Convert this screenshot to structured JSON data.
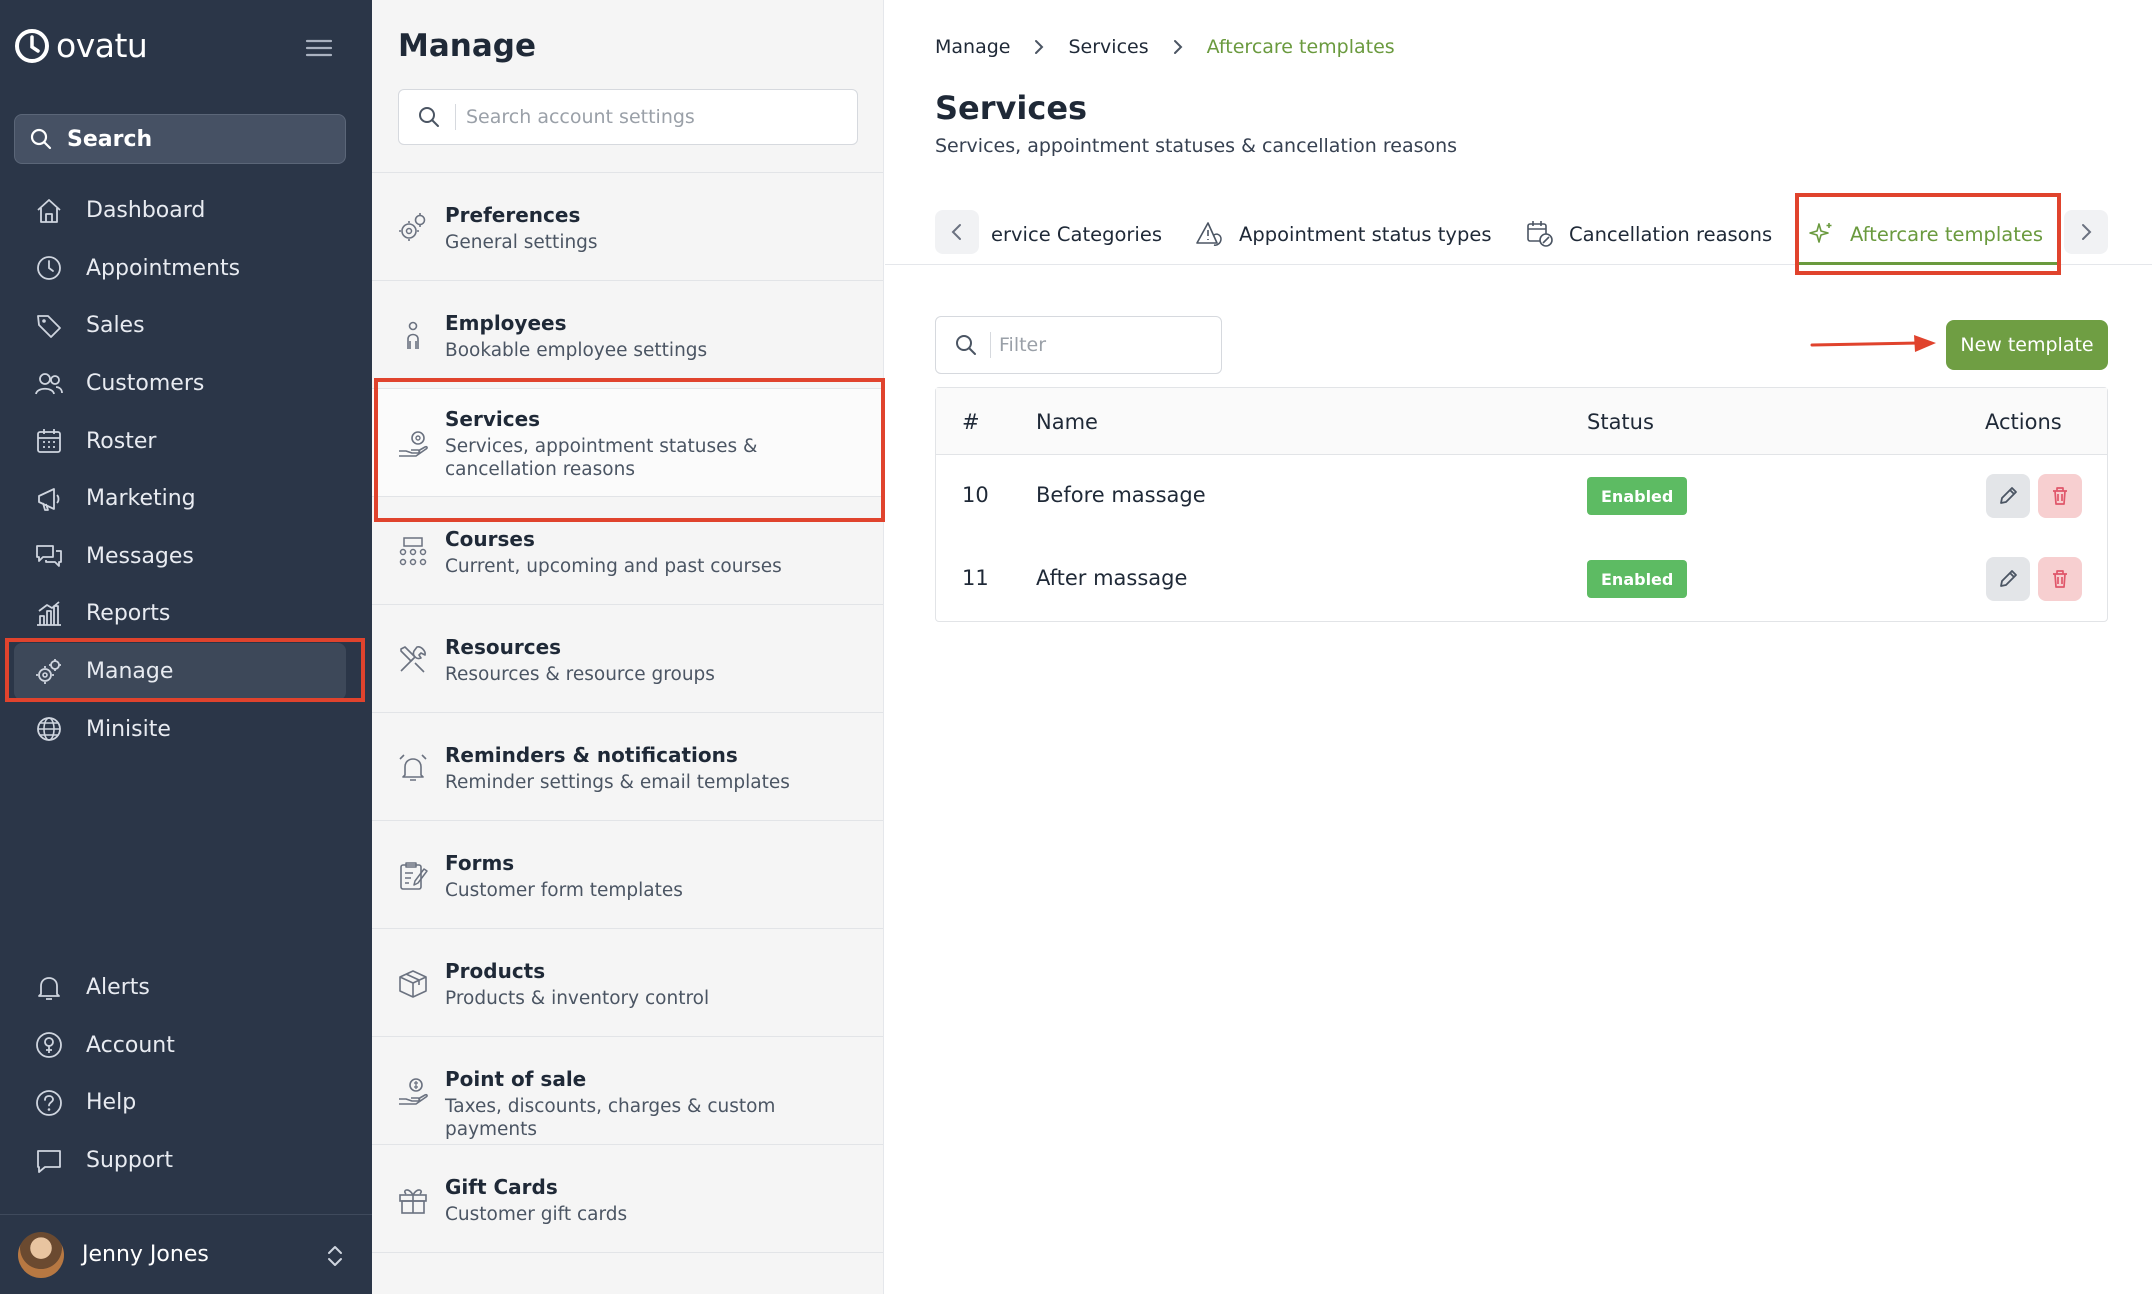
{
  "app": {
    "brand": "ovatu"
  },
  "sidebar": {
    "search_label": "Search",
    "items": [
      {
        "label": "Dashboard",
        "icon": "home-icon"
      },
      {
        "label": "Appointments",
        "icon": "clock-icon"
      },
      {
        "label": "Sales",
        "icon": "tag-icon"
      },
      {
        "label": "Customers",
        "icon": "users-icon"
      },
      {
        "label": "Roster",
        "icon": "calendar-icon"
      },
      {
        "label": "Marketing",
        "icon": "megaphone-icon"
      },
      {
        "label": "Messages",
        "icon": "chat-icon"
      },
      {
        "label": "Reports",
        "icon": "chart-icon"
      },
      {
        "label": "Manage",
        "icon": "gears-icon",
        "active": true
      },
      {
        "label": "Minisite",
        "icon": "globe-icon"
      }
    ],
    "bottom_items": [
      {
        "label": "Alerts",
        "icon": "bell-icon"
      },
      {
        "label": "Account",
        "icon": "account-icon"
      },
      {
        "label": "Help",
        "icon": "help-icon"
      },
      {
        "label": "Support",
        "icon": "support-icon"
      }
    ],
    "user": {
      "name": "Jenny Jones"
    }
  },
  "manage": {
    "title": "Manage",
    "search_placeholder": "Search account settings",
    "items": [
      {
        "title": "Preferences",
        "subtitle": "General settings",
        "icon": "gears-icon"
      },
      {
        "title": "Employees",
        "subtitle": "Bookable employee settings",
        "icon": "person-icon"
      },
      {
        "title": "Services",
        "subtitle": "Services, appointment statuses & cancellation reasons",
        "icon": "hand-gear-icon",
        "active": true
      },
      {
        "title": "Courses",
        "subtitle": "Current, upcoming and past courses",
        "icon": "group-icon"
      },
      {
        "title": "Resources",
        "subtitle": "Resources & resource groups",
        "icon": "tools-icon"
      },
      {
        "title": "Reminders & notifications",
        "subtitle": "Reminder settings & email templates",
        "icon": "alarm-icon"
      },
      {
        "title": "Forms",
        "subtitle": "Customer form templates",
        "icon": "form-icon"
      },
      {
        "title": "Products",
        "subtitle": "Products & inventory control",
        "icon": "box-icon"
      },
      {
        "title": "Point of sale",
        "subtitle": "Taxes, discounts, charges & custom payments",
        "icon": "money-hand-icon"
      },
      {
        "title": "Gift Cards",
        "subtitle": "Customer gift cards",
        "icon": "gift-icon"
      }
    ]
  },
  "main": {
    "breadcrumb": [
      "Manage",
      "Services",
      "Aftercare templates"
    ],
    "title": "Services",
    "subtitle": "Services, appointment statuses & cancellation reasons",
    "tabs": [
      {
        "label": "ervice Categories",
        "icon": ""
      },
      {
        "label": "Appointment status types",
        "icon": "warning-icon"
      },
      {
        "label": "Cancellation reasons",
        "icon": "calendar-x-icon"
      },
      {
        "label": "Aftercare templates",
        "icon": "sparkle-icon",
        "active": true
      }
    ],
    "filter_placeholder": "Filter",
    "new_button": "New template",
    "table": {
      "columns": [
        "#",
        "Name",
        "Status",
        "Actions"
      ],
      "rows": [
        {
          "id": "10",
          "name": "Before massage",
          "status": "Enabled"
        },
        {
          "id": "11",
          "name": "After massage",
          "status": "Enabled"
        }
      ]
    }
  },
  "colors": {
    "sidebar_bg": "#2b3648",
    "accent_green": "#6f9e43",
    "badge_green": "#5dbb63",
    "highlight_red": "#e0432d"
  }
}
